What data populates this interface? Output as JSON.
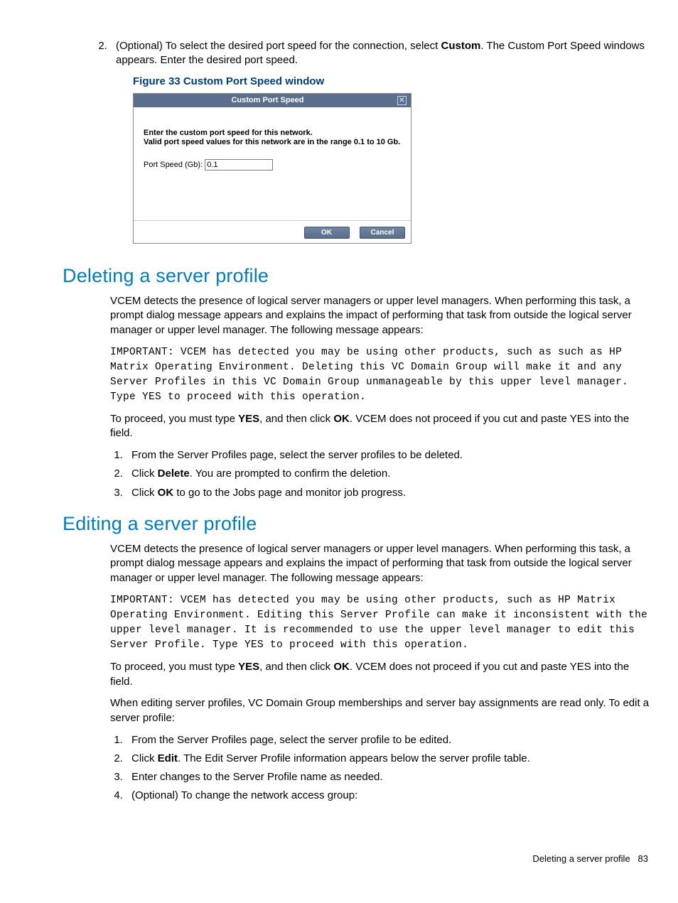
{
  "step2": {
    "num": "2.",
    "pre": "(Optional) To select the desired port speed for the connection, select ",
    "bold": "Custom",
    "post": ". The Custom Port Speed windows appears. Enter the desired port speed."
  },
  "figure": {
    "caption": "Figure 33 Custom Port Speed window",
    "title": "Custom Port Speed",
    "line1": "Enter the custom port speed for this network.",
    "line2": "Valid port speed values for this network are in the range 0.1 to 10 Gb.",
    "field_label": "Port Speed (Gb):",
    "field_value": "0.1",
    "ok": "OK",
    "cancel": "Cancel"
  },
  "del": {
    "heading": "Deleting a server profile",
    "p1": "VCEM detects the presence of logical server managers or upper level managers. When performing this task, a prompt dialog message appears and explains the impact of performing that task from outside the logical server manager or upper level manager. The following message appears:",
    "code": "IMPORTANT: VCEM has detected you may be using other products, such as such as HP Matrix Operating Environment. Deleting this VC Domain Group will make it and any Server Profiles in this VC Domain Group unmanageable by this upper level manager. Type YES to proceed with this operation.",
    "p2a": "To proceed, you must type ",
    "p2b": "YES",
    "p2c": ", and then click ",
    "p2d": "OK",
    "p2e": ". VCEM does not proceed if you cut and paste YES into the field.",
    "li1": "From the Server Profiles page, select the server profiles to be deleted.",
    "li2a": "Click ",
    "li2b": "Delete",
    "li2c": ". You are prompted to confirm the deletion.",
    "li3a": "Click ",
    "li3b": "OK",
    "li3c": " to go to the Jobs page and monitor job progress."
  },
  "edit": {
    "heading": "Editing a server profile",
    "p1": "VCEM detects the presence of logical server managers or upper level managers. When performing this task, a prompt dialog message appears and explains the impact of performing that task from outside the logical server manager or upper level manager. The following message appears:",
    "code": "IMPORTANT: VCEM has detected you may be using other products, such as HP Matrix Operating Environment. Editing this Server Profile can make it inconsistent with the upper level manager. It is recommended to use the upper level manager to edit this Server Profile. Type YES to proceed with this operation.",
    "p2a": "To proceed, you must type ",
    "p2b": "YES",
    "p2c": ", and then click ",
    "p2d": "OK",
    "p2e": ". VCEM does not proceed if you cut and paste YES into the field.",
    "p3": "When editing server profiles, VC Domain Group memberships and server bay assignments are read only. To edit a server profile:",
    "li1": "From the Server Profiles page, select the server profile to be edited.",
    "li2a": "Click ",
    "li2b": "Edit",
    "li2c": ". The Edit Server Profile information appears below the server profile table.",
    "li3": "Enter changes to the Server Profile name as needed.",
    "li4": "(Optional) To change the network access group:"
  },
  "footer": {
    "section": "Deleting a server profile",
    "page": "83"
  }
}
